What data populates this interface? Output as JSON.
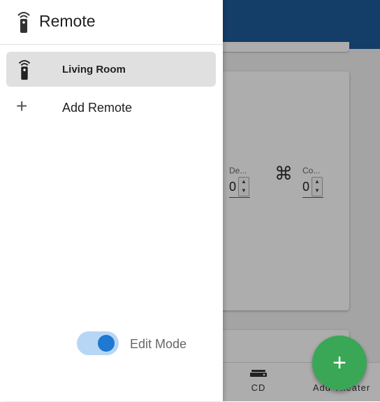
{
  "drawer": {
    "title": "Remote",
    "items": [
      {
        "label": "Living Room",
        "icon": "remote-icon",
        "active": true
      },
      {
        "label": "Add Remote",
        "icon": "plus-icon",
        "active": false
      }
    ],
    "edit_mode": {
      "label": "Edit Mode",
      "on": true
    }
  },
  "background": {
    "card": {
      "fields": [
        {
          "label": "De...",
          "value": "0"
        },
        {
          "label": "Co...",
          "value": "0"
        }
      ],
      "command_icon": "command-icon",
      "command_glyph": "⌘"
    },
    "bottom_nav": [
      {
        "label": "CD",
        "icon": "cd-player-icon"
      },
      {
        "label": "Add Theater",
        "icon": "theater-icon"
      }
    ],
    "fab_symbol": "+"
  },
  "colors": {
    "header": "#1e5a9a",
    "fab": "#3aa757",
    "toggle_knob": "#1f78d1",
    "toggle_track": "#b7d6f5"
  }
}
